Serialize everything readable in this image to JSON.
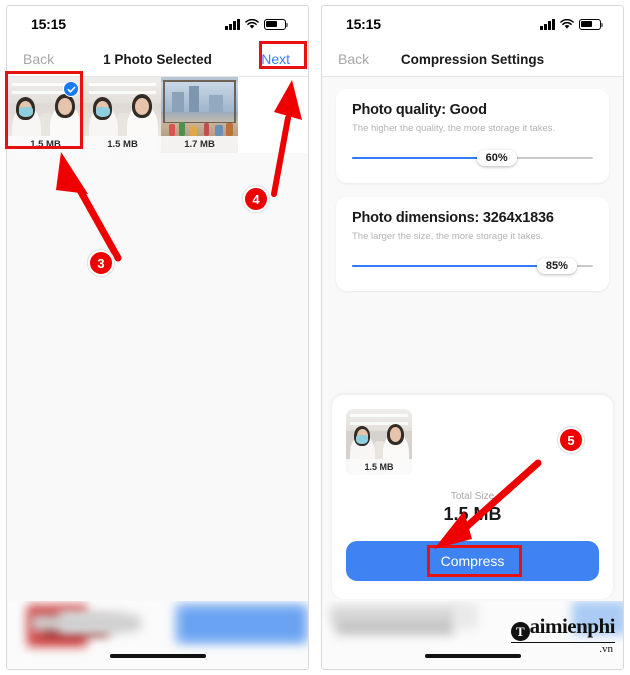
{
  "meta": {
    "accent_blue": "#3f83f3",
    "annotation_red": "#ee0000",
    "slider_blue": "#2f7cf6"
  },
  "left_phone": {
    "status": {
      "time": "15:15",
      "signal_icon": "cellular-bars-icon",
      "wifi_icon": "wifi-icon",
      "battery_icon": "battery-icon"
    },
    "nav": {
      "back_label": "Back",
      "title": "1 Photo Selected",
      "next_label": "Next"
    },
    "photos": [
      {
        "size": "1.5 MB",
        "selected": true,
        "scene": "people"
      },
      {
        "size": "1.5 MB",
        "selected": false,
        "scene": "people"
      },
      {
        "size": "1.7 MB",
        "selected": false,
        "scene": "room"
      }
    ]
  },
  "right_phone": {
    "status": {
      "time": "15:15",
      "signal_icon": "cellular-bars-icon",
      "wifi_icon": "wifi-icon",
      "battery_icon": "battery-icon"
    },
    "nav": {
      "back_label": "Back",
      "title": "Compression Settings"
    },
    "settings": [
      {
        "title": "Photo quality: Good",
        "subtitle": "The higher the quality, the more storage it takes.",
        "value_label": "60%",
        "percent": 60
      },
      {
        "title": "Photo dimensions: 3264x1836",
        "subtitle": "The larger the size, the more storage it takes.",
        "value_label": "85%",
        "percent": 85
      }
    ],
    "summary": {
      "thumb_size": "1.5 MB",
      "total_label": "Total Size",
      "total_value": "1.5 MB",
      "compress_label": "Compress"
    }
  },
  "annotations": {
    "steps": [
      {
        "number": "3",
        "target": "selected-photo-thumbnail"
      },
      {
        "number": "4",
        "target": "next-button"
      },
      {
        "number": "5",
        "target": "compress-button"
      }
    ]
  },
  "watermark": {
    "initial": "T",
    "text": "aimienphi",
    "tld": ".vn"
  }
}
